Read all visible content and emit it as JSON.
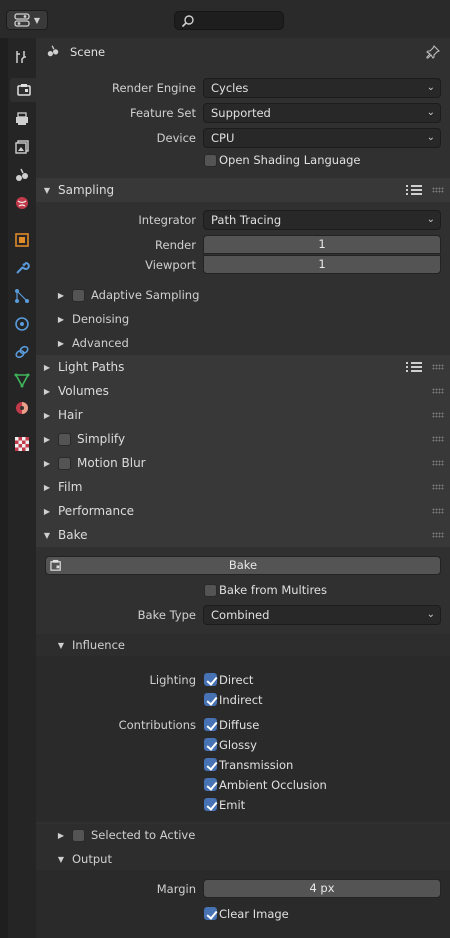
{
  "header": {
    "context_title": "Scene",
    "search": {
      "value": "",
      "placeholder": ""
    }
  },
  "tabs": [
    "tool-icon",
    "render-icon",
    "output-icon",
    "view-layer-icon",
    "scene-icon",
    "world-icon",
    "object-icon",
    "modifier-icon",
    "particles-icon",
    "physics-icon",
    "constraints-icon",
    "data-icon",
    "material-icon",
    "texture-icon"
  ],
  "render": {
    "engine_label": "Render Engine",
    "engine_value": "Cycles",
    "feature_label": "Feature Set",
    "feature_value": "Supported",
    "device_label": "Device",
    "device_value": "CPU",
    "osl_label": "Open Shading Language"
  },
  "sampling": {
    "title": "Sampling",
    "integrator_label": "Integrator",
    "integrator_value": "Path Tracing",
    "render_label": "Render",
    "render_value": "1",
    "viewport_label": "Viewport",
    "viewport_value": "1",
    "adaptive": "Adaptive Sampling",
    "denoising": "Denoising",
    "advanced": "Advanced"
  },
  "sections": {
    "light_paths": "Light Paths",
    "volumes": "Volumes",
    "hair": "Hair",
    "simplify": "Simplify",
    "motion_blur": "Motion Blur",
    "film": "Film",
    "performance": "Performance"
  },
  "bake": {
    "title": "Bake",
    "button": "Bake",
    "from_multires": "Bake from Multires",
    "type_label": "Bake Type",
    "type_value": "Combined",
    "influence": "Influence",
    "lighting_label": "Lighting",
    "direct": "Direct",
    "indirect": "Indirect",
    "contributions_label": "Contributions",
    "diffuse": "Diffuse",
    "glossy": "Glossy",
    "transmission": "Transmission",
    "ao": "Ambient Occlusion",
    "emit": "Emit",
    "selected_to_active": "Selected to Active",
    "output": "Output",
    "margin_label": "Margin",
    "margin_value": "4 px",
    "clear_image": "Clear Image"
  },
  "colors": {
    "accent": "#4772b3",
    "panel": "#303030",
    "header": "#383838"
  }
}
